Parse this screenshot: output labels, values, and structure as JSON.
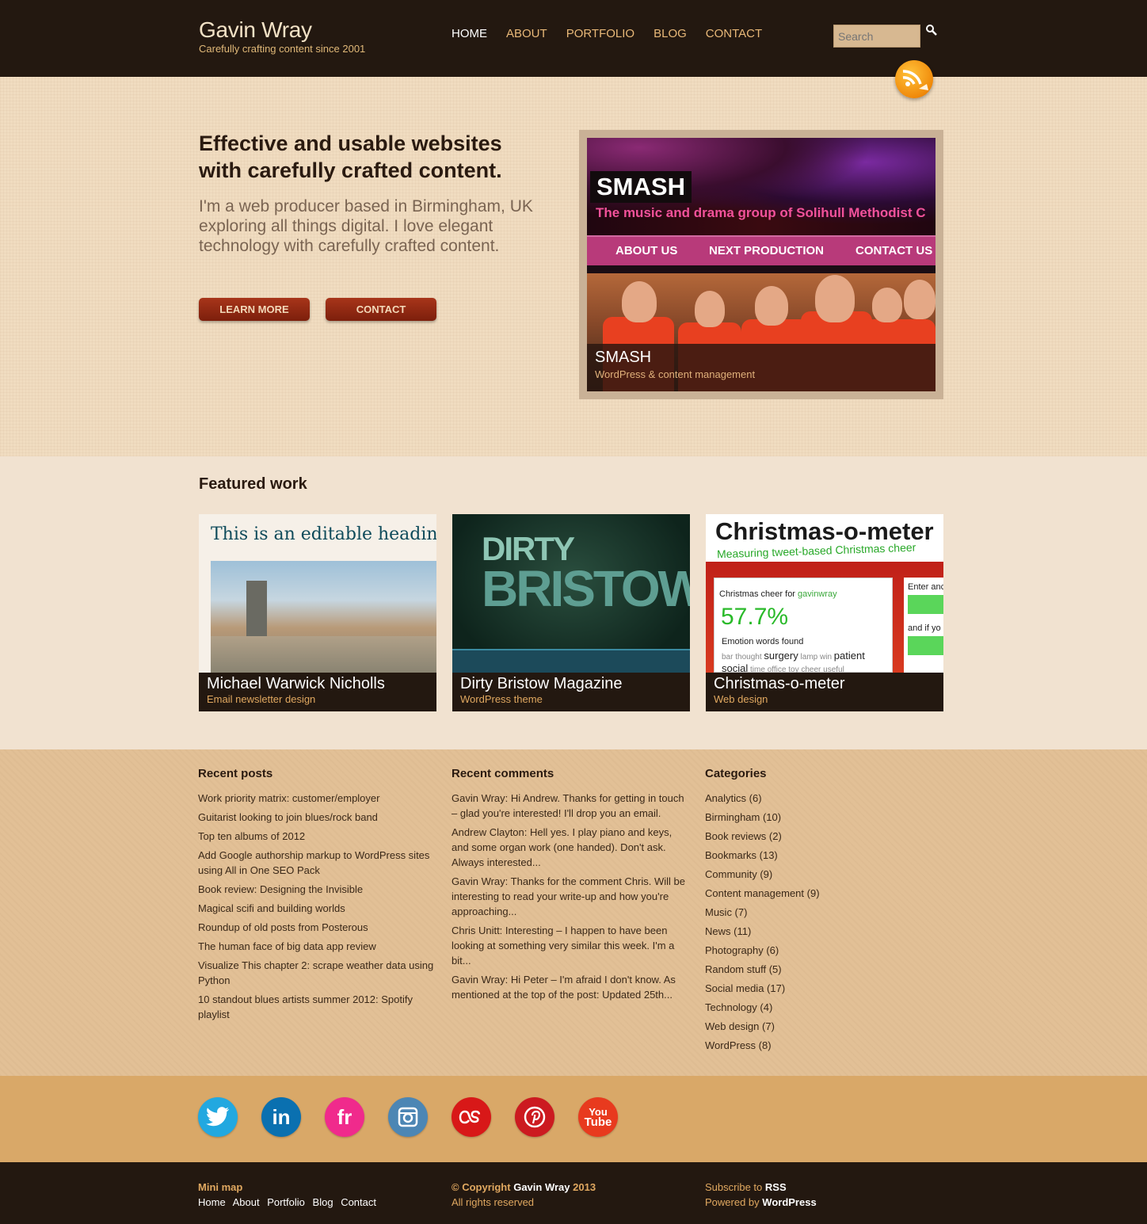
{
  "header": {
    "site_title": "Gavin Wray",
    "tagline": "Carefully crafting content since 2001",
    "nav": [
      "HOME",
      "ABOUT",
      "PORTFOLIO",
      "BLOG",
      "CONTACT"
    ],
    "search_placeholder": "Search"
  },
  "hero": {
    "heading": "Effective and usable websites with carefully crafted content.",
    "intro": "I'm a web producer based in Birmingham, UK exploring all things digital. I love elegant technology with carefully crafted content.",
    "learn_more": "LEARN MORE",
    "contact": "CONTACT",
    "showcase": {
      "brand": "SMASH",
      "tagline": "The music and drama group of Solihull Methodist C",
      "nav": [
        "ABOUT US",
        "NEXT PRODUCTION",
        "CONTACT US"
      ],
      "caption_title": "SMASH",
      "caption_sub": "WordPress & content management"
    }
  },
  "featured": {
    "title": "Featured work",
    "cards": [
      {
        "title": "Michael Warwick Nicholls",
        "sub": "Email newsletter design",
        "thumb_heading": "This is an editable headin"
      },
      {
        "title": "Dirty Bristow Magazine",
        "sub": "WordPress theme",
        "thumb_line1": "DIRTY",
        "thumb_line2": "BRISTOW"
      },
      {
        "title": "Christmas-o-meter",
        "sub": "Web design",
        "thumb_title": "Christmas-o-meter",
        "thumb_subtitle": "Measuring tweet-based Christmas cheer",
        "thumb_cheer_for": "Christmas cheer for",
        "thumb_user": "gavinwray",
        "thumb_percent": "57.7%",
        "thumb_emotion": "Emotion words found",
        "thumb_words": [
          "bar",
          "thought",
          "surgery",
          "lamp",
          "win",
          "patient"
        ],
        "thumb_words2": [
          "social",
          "time",
          "office",
          "toy",
          "cheer",
          "useful"
        ],
        "thumb_side1": "Enter anc",
        "thumb_side2": "and if yo"
      }
    ]
  },
  "widgets": {
    "recent_posts": {
      "title": "Recent posts",
      "items": [
        "Work priority matrix: customer/employer",
        "Guitarist looking to join blues/rock band",
        "Top ten albums of 2012",
        "Add Google authorship markup to WordPress sites using All in One SEO Pack",
        "Book review: Designing the Invisible",
        "Magical scifi and building worlds",
        "Roundup of old posts from Posterous",
        "The human face of big data app review",
        "Visualize This chapter 2: scrape weather data using Python",
        "10 standout blues artists summer 2012: Spotify playlist"
      ]
    },
    "recent_comments": {
      "title": "Recent comments",
      "items": [
        "Gavin Wray: Hi Andrew. Thanks for getting in touch – glad you're interested! I'll drop you an email.",
        "Andrew Clayton: Hell yes. I play piano and keys, and some organ work (one handed). Don't ask. Always interested...",
        "Gavin Wray: Thanks for the comment Chris. Will be interesting to read your write-up and how you're approaching...",
        "Chris Unitt: Interesting – I happen to have been looking at something very similar this week. I'm a bit...",
        "Gavin Wray: Hi Peter – I'm afraid I don't know. As mentioned at the top of the post: Updated 25th..."
      ]
    },
    "categories": {
      "title": "Categories",
      "items": [
        "Analytics (6)",
        "Birmingham (10)",
        "Book reviews (2)",
        "Bookmarks (13)",
        "Community (9)",
        "Content management (9)",
        "Music (7)",
        "News (11)",
        "Photography (6)",
        "Random stuff (5)",
        "Social media (17)",
        "Technology (4)",
        "Web design (7)",
        "WordPress (8)"
      ]
    }
  },
  "social": {
    "icons": [
      "twitter-icon",
      "linkedin-icon",
      "friendfeed-icon",
      "instagram-icon",
      "lastfm-icon",
      "pinterest-icon",
      "youtube-icon"
    ],
    "labels": {
      "linkedin": "in",
      "friendfeed": "fr",
      "youtube_1": "You",
      "youtube_2": "Tube"
    },
    "colors": {
      "twitter": "#22a8e0",
      "linkedin": "#0a70b0",
      "friendfeed": "#f02a8c",
      "instagram": "#4c86b4",
      "lastfm": "#d81818",
      "pinterest": "#cc1a20",
      "youtube": "#e83a1e"
    }
  },
  "footer": {
    "minimap_title": "Mini map",
    "minimap_links": [
      "Home",
      "About",
      "Portfolio",
      "Blog",
      "Contact"
    ],
    "copyright_prefix": "© Copyright",
    "copyright_name": "Gavin Wray",
    "copyright_year": "2013",
    "rights": "All rights reserved",
    "subscribe_prefix": "Subscribe to",
    "subscribe_link": "RSS",
    "powered_prefix": "Powered by",
    "powered_link": "WordPress"
  },
  "colors": {
    "header_bg": "#231810",
    "accent_orange": "#e0a860",
    "button_red": "#8f2a12",
    "hero_bg": "#f0dcc0",
    "widgets_bg": "#e2c096"
  }
}
